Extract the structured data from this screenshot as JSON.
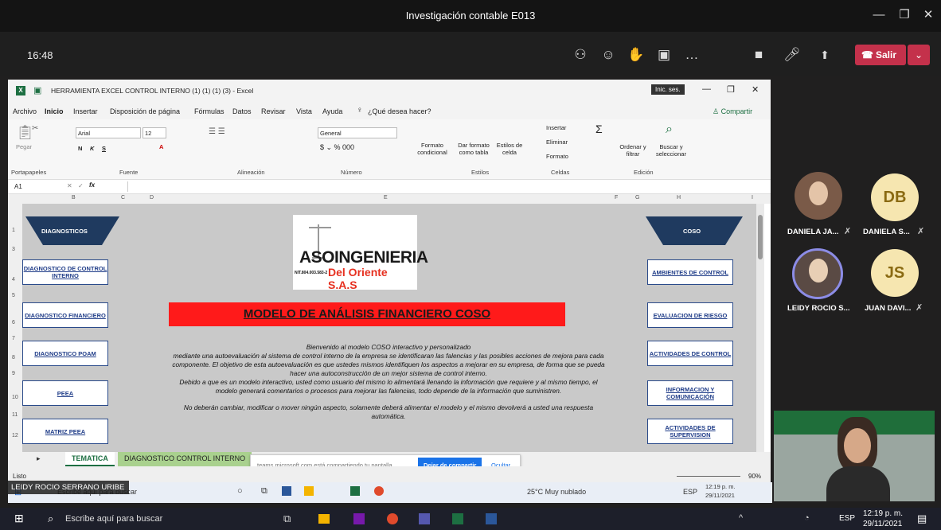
{
  "teams": {
    "title": "Investigación contable E013",
    "clock": "16:48",
    "leave_label": "Salir"
  },
  "excel": {
    "file_title": "HERRAMIENTA EXCEL CONTROL INTERNO (1) (1) (1) (3) - Excel",
    "signin": "Inic. ses.",
    "menu": [
      "Archivo",
      "Inicio",
      "Insertar",
      "Disposición de página",
      "Fórmulas",
      "Datos",
      "Revisar",
      "Vista",
      "Ayuda",
      "¿Qué desea hacer?"
    ],
    "share": "Compartir",
    "font_name": "Arial",
    "font_size": "12",
    "number_format": "General",
    "paste_label": "Pegar",
    "groups": [
      "Portapapeles",
      "Fuente",
      "Alineación",
      "Número",
      "Estilos",
      "Celdas",
      "Edición"
    ],
    "styles": [
      "Formato condicional",
      "Dar formato como tabla",
      "Estilos de celda"
    ],
    "cells": [
      "Insertar",
      "Eliminar",
      "Formato"
    ],
    "edit": [
      "Ordenar y filtrar",
      "Buscar y seleccionar"
    ],
    "name_box": "A1",
    "columns": [
      "B",
      "C",
      "D",
      "E",
      "F",
      "G",
      "H",
      "I"
    ],
    "rows": [
      "1",
      "3",
      "4",
      "5",
      "6",
      "7",
      "8",
      "9",
      "10",
      "11",
      "12"
    ],
    "left_header": "DIAGNOSTICOS",
    "right_header": "COSO",
    "left_links": [
      "DIAGNOSTICO DE CONTROL INTERNO",
      "DIAGNOSTICO FINANCIERO",
      "DIAGNOSTICO POAM",
      "PEEA",
      "MATRIZ PEEA"
    ],
    "right_links": [
      "AMBIENTES DE CONTROL",
      "EVALUACION DE RIESGO",
      "ACTIVIDADES DE CONTROL",
      "INFORMACION Y COMUNICACIÓN",
      "ACTIVIDADES DE SUPERVISION"
    ],
    "logo_top": "ASOINGENIERIA",
    "logo_nit": "NIT.804.003.583-2",
    "logo_bottom": "Del Oriente S.A.S",
    "banner": "MODELO DE ANÁLISIS FINANCIERO COSO",
    "intro": "Bienvenido al modelo COSO interactivo y personalizado",
    "para1": "mediante una autoevaluación al sistema de control interno de la empresa se identificaran las falencias y las posibles acciones de mejora para cada componente. El objetivo de esta autoevaluación es que ustedes mismos identifiquen los aspectos a mejorar en su empresa, de forma que se pueda hacer una autoconstrucción de un mejor sistema de control interno.",
    "para2": "Debido a que es un modelo interactivo, usted como usuario del mismo lo alimentará llenando la información que requiere y al mismo tiempo, el modelo generará comentarios o procesos para mejorar las falencias, todo depende de la información que suministren.",
    "para3": "No deberán cambiar, modificar o mover ningún aspecto, solamente deberá alimentar el modelo y el mismo devolverá a usted una respuesta automática.",
    "tabs": [
      "TEMATICA",
      "DIAGNOSTICO CONTROL INTERNO"
    ],
    "share_notice": "teams.microsoft.com está compartiendo tu pantalla.",
    "stop_share": "Dejar de compartir",
    "hide": "Ocultar",
    "status": "Listo",
    "zoom": "90%"
  },
  "participants": [
    {
      "name": "DANIELA JA...",
      "initials": ""
    },
    {
      "name": "DANIELA S...",
      "initials": "DB"
    },
    {
      "name": "LEIDY ROCIO S...",
      "initials": ""
    },
    {
      "name": "JUAN DAVI...",
      "initials": "JS"
    }
  ],
  "presenter_label": "LEIDY ROCIO SERRANO URIBE",
  "inner_taskbar": {
    "search": "Escribe aquí para buscar",
    "weather": "25°C  Muy nublado",
    "lang": "ESP",
    "time": "12:19 p. m.",
    "date": "29/11/2021"
  },
  "taskbar": {
    "search": "Escribe aquí para buscar",
    "lang": "ESP",
    "time": "12:19 p. m.",
    "date": "29/11/2021"
  },
  "colors": {
    "accent": "#c4314b",
    "banner": "#ff1a1a",
    "navy": "#1f3c88"
  }
}
